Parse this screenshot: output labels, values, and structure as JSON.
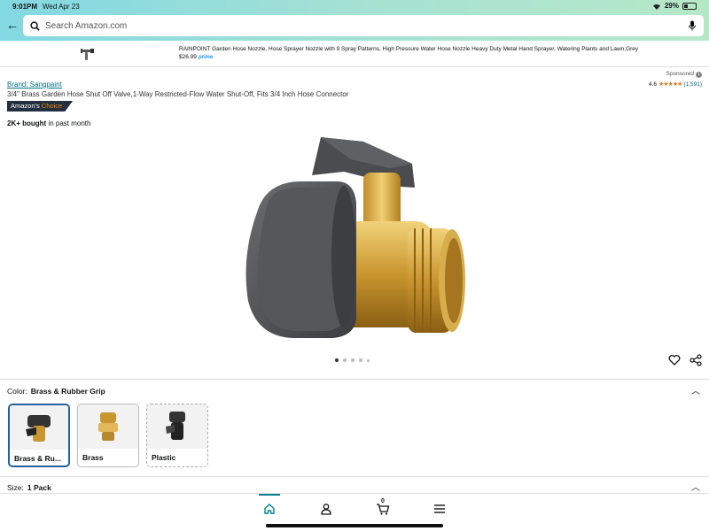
{
  "status_bar": {
    "time": "9:01PM",
    "date": "Wed Apr 23",
    "battery": "29%"
  },
  "search": {
    "placeholder": "Search Amazon.com"
  },
  "ad": {
    "title": "RAINPOINT Garden Hose Nozzle, Hose Sprayer Nozzle with 9 Spray Patterns, High Pressure Water Hose Nozzle Heavy Duty Metal Hand Sprayer, Watering Plants and Lawn,Grey",
    "price": "$26.99",
    "prime": "prime"
  },
  "product": {
    "sponsored_label": "Sponsored",
    "rating_value": "4.6",
    "stars": "★★★★★",
    "rating_count": "(1,591)",
    "brand": "Brand: Sangpaint",
    "title": "3/4\" Brass Garden Hose Shut Off Valve,1-Way Restricted-Flow Water Shut-Off, Fits 3/4 Inch Hose Connector",
    "badge_part1": "Amazon's",
    "badge_part2": "Choice",
    "bought_bold": "2K+ bought",
    "bought_rest": " in past month"
  },
  "carousel": {
    "total": 5,
    "active_index": 0
  },
  "color": {
    "label": "Color:",
    "selected": "Brass & Rubber Grip",
    "options": [
      {
        "label": "Brass & Ru..."
      },
      {
        "label": "Brass"
      },
      {
        "label": "Plastic"
      }
    ]
  },
  "size": {
    "label": "Size:",
    "selected": "1 Pack"
  },
  "cart": {
    "count": "0"
  },
  "colors": {
    "accent": "#008296",
    "link": "#007185",
    "star": "#de7921",
    "selected_border": "#2162a1"
  }
}
